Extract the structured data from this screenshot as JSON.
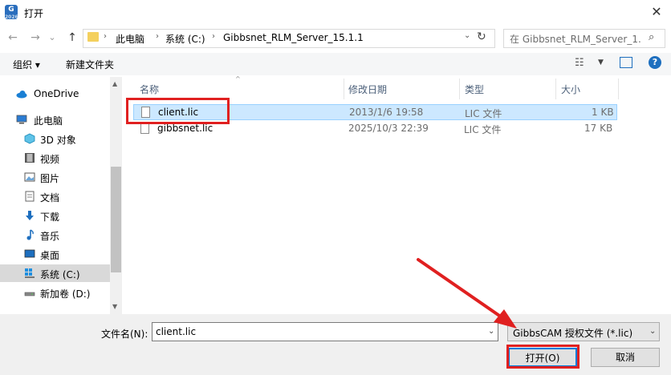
{
  "window": {
    "title": "打开",
    "app_icon_text": "G",
    "app_icon_sub": "2026",
    "close_glyph": "✕"
  },
  "nav": {
    "back_glyph": "←",
    "forward_glyph": "→",
    "history_glyph": "⌄",
    "up_glyph": "↑",
    "breadcrumbs": [
      "此电脑",
      "系统 (C:)",
      "Gibbsnet_RLM_Server_15.1.1"
    ],
    "separator": "›",
    "search_placeholder": "在 Gibbsnet_RLM_Server_1..."
  },
  "toolbar": {
    "organize_label": "组织 ▾",
    "new_folder_label": "新建文件夹",
    "view_dd": "▼",
    "help": "?"
  },
  "sidebar": {
    "items": [
      {
        "label": "OneDrive",
        "icon": "cloud-icon"
      },
      {
        "label": "此电脑",
        "icon": "computer-icon"
      },
      {
        "label": "3D 对象",
        "icon": "cube-icon"
      },
      {
        "label": "视频",
        "icon": "video-icon"
      },
      {
        "label": "图片",
        "icon": "picture-icon"
      },
      {
        "label": "文档",
        "icon": "document-icon"
      },
      {
        "label": "下载",
        "icon": "download-icon"
      },
      {
        "label": "音乐",
        "icon": "music-icon"
      },
      {
        "label": "桌面",
        "icon": "desktop-icon"
      },
      {
        "label": "系统 (C:)",
        "icon": "windows-drive-icon",
        "selected": true
      },
      {
        "label": "新加卷 (D:)",
        "icon": "drive-icon"
      }
    ]
  },
  "file_list": {
    "columns": [
      "名称",
      "修改日期",
      "类型",
      "大小"
    ],
    "rows": [
      {
        "name": "client.lic",
        "date": "2013/1/6 19:58",
        "type": "LIC 文件",
        "size": "1 KB",
        "selected": true
      },
      {
        "name": "gibbsnet.lic",
        "date": "2025/10/3 22:39",
        "type": "LIC 文件",
        "size": "17 KB",
        "selected": false
      }
    ]
  },
  "bottom": {
    "filename_label": "文件名(N):",
    "filename_value": "client.lic",
    "filter_value": "GibbsCAM 授权文件 (*.lic)",
    "open_label": "打开(O)",
    "cancel_label": "取消"
  },
  "colors": {
    "selection": "#cce8ff",
    "annotation_red": "#e02020",
    "accent": "#0078d7"
  }
}
